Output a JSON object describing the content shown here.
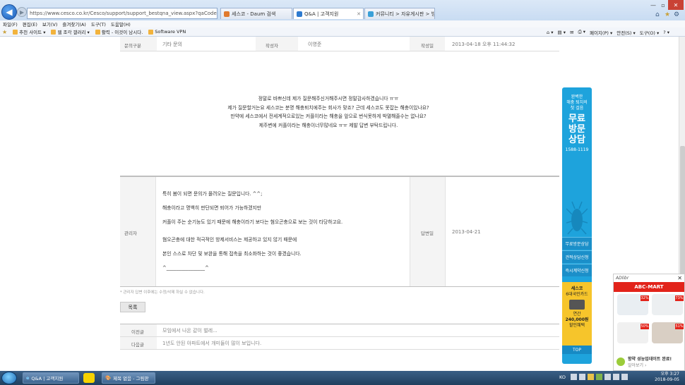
{
  "browser": {
    "address": "https://www.cesco.co.kr/Cesco/support/support_bestqna_view.aspx?qaCode=2503268",
    "tabs": [
      {
        "label": "세스코 - Daum 검색",
        "icon_color": "#e07a2e"
      },
      {
        "label": "Q&A | 고객지원",
        "icon_color": "#2e7bd0"
      },
      {
        "label": "커뮤니티 > 자유게시판 > 방...",
        "icon_color": "#3aa0d8"
      }
    ],
    "menu": [
      "파일(F)",
      "편집(E)",
      "보기(V)",
      "즐겨찾기(A)",
      "도구(T)",
      "도움말(H)"
    ],
    "favorites": [
      "추천 사이트 ▾",
      "웹 조각 갤러리 ▾",
      "활력 - 이것이 남시다.",
      "Software VPN"
    ],
    "commands": [
      "페이지(P) ▾",
      "안전(S) ▾",
      "도구(O) ▾"
    ]
  },
  "question_meta": {
    "category_label": "문의구분",
    "category_value": "기타 문의",
    "author_label": "작성자",
    "author_value": "이영준",
    "date_label": "작성일",
    "date_value": "2013-04-18 오후 11:44:32"
  },
  "question_lines": [
    "정말로 바쁘신데 제가 질문해주신거해주시면 정말감사하겠습니다 ㅠㅠ",
    "제가 질문할거는요 세스코는 분명 해충퇴치에주는 회사가 맞죠? 근데 세스코도 못잡는 해충이있나요?",
    "만약에 세스코에서 전세계적으로있는 커플이라는 해충을 앞으로 번식못하게 박멸해줄수는 없나요?",
    "제주변에 커플이라는 해충이너무많네요 ㅠㅠ 제발 답변 부탁드립니다."
  ],
  "answer": {
    "author_label": "관리자",
    "date_label": "답변일",
    "date_value": "2013-04-21",
    "lines": [
      "특히 봄이 되면 문의가 몰려오는 질문입니다. ^^;",
      "해충이라고 명백히 판단되면 퇴어가 가능하겠지만",
      "커플이 주는 순기능도 있기 때문에 해충이라기 보다는 혐오곤충으로 보는 것이 타당하고요.",
      "혐오곤충에 대한 적극적인 방제서비스는 제공하고 있지 않기 때문에",
      "본인 스스로 차단 및 보완을 통해 접촉을 최소화하는 것이 좋겠습니다.",
      "^________________^"
    ]
  },
  "note": "* 관리자 답변 이후에는 수정/삭제 하실 수 없습니다.",
  "list_button": "목록",
  "nav": {
    "prev_label": "이전글",
    "prev_title": "모임에서 나온 같이 벌레...",
    "next_label": "다음글",
    "next_title": "1년도 안된 아파트에서 개미들이 많이 보입니다."
  },
  "side_banner": {
    "intro": [
      "완벽한",
      "해충 퇴치의",
      "첫 걸음"
    ],
    "headline": [
      "무료",
      "방문",
      "상담"
    ],
    "phone": "1588-1119",
    "items": [
      "무료방문상담",
      "견적상담신청",
      "즉시계약신청"
    ],
    "promo": [
      "세스코",
      "6대국민카드",
      "연간",
      "240,000원",
      "할인혜택"
    ],
    "top": "TOP"
  },
  "ad": {
    "network": "ADlibr",
    "brand": "ABC-MART",
    "discounts": [
      "32%",
      "73%",
      "50%",
      "51%"
    ],
    "footer_title": "항약 성능업데이트 완료!",
    "footer_sub": "알아보기 ›"
  },
  "taskbar": {
    "tasks": [
      "Q&A | 고객지원",
      "제목 없음 - 그림판"
    ],
    "tray_lang": "KO",
    "clock_time": "오후 3:27",
    "clock_date": "2018-09-05"
  }
}
